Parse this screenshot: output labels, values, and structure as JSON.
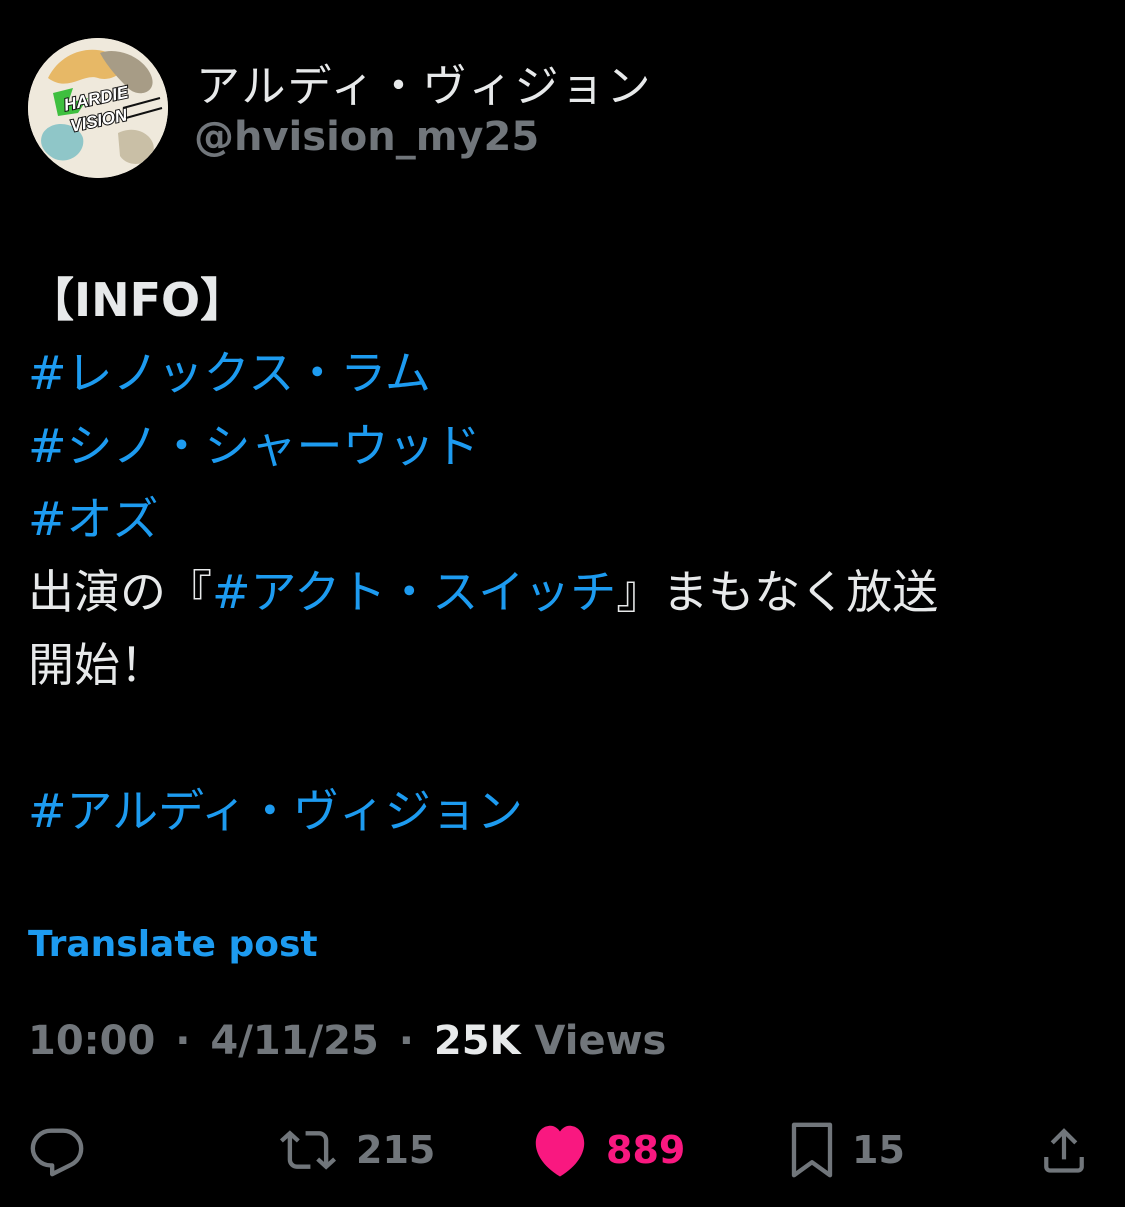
{
  "author": {
    "display_name": "アルディ・ヴィジョン",
    "handle": "@hvision_my25",
    "avatar_text": "HARDIE VISION"
  },
  "tweet": {
    "info_tag": "【INFO】",
    "hashtag_1": "#レノックス・ラム",
    "hashtag_2": "#シノ・シャーウッド",
    "hashtag_3": "#オズ",
    "line_prefix": "出演の『",
    "hashtag_4": "#アクト・スイッチ",
    "line_suffix": "』まもなく放送",
    "line_2": "開始！",
    "hashtag_5": "#アルディ・ヴィジョン"
  },
  "translate_label": "Translate post",
  "meta": {
    "time": "10:00",
    "date": "4/11/25",
    "separator": "·",
    "views_count": "25K",
    "views_label": "Views"
  },
  "actions": {
    "reply_icon": "reply-icon",
    "repost_icon": "repost-icon",
    "repost_count": "215",
    "like_icon": "heart-filled-icon",
    "like_count": "889",
    "bookmark_icon": "bookmark-icon",
    "bookmark_count": "15",
    "share_icon": "share-icon"
  },
  "colors": {
    "background": "#000000",
    "text": "#e7e9ea",
    "secondary": "#71767b",
    "link": "#1d9bf0",
    "like": "#f91880"
  }
}
